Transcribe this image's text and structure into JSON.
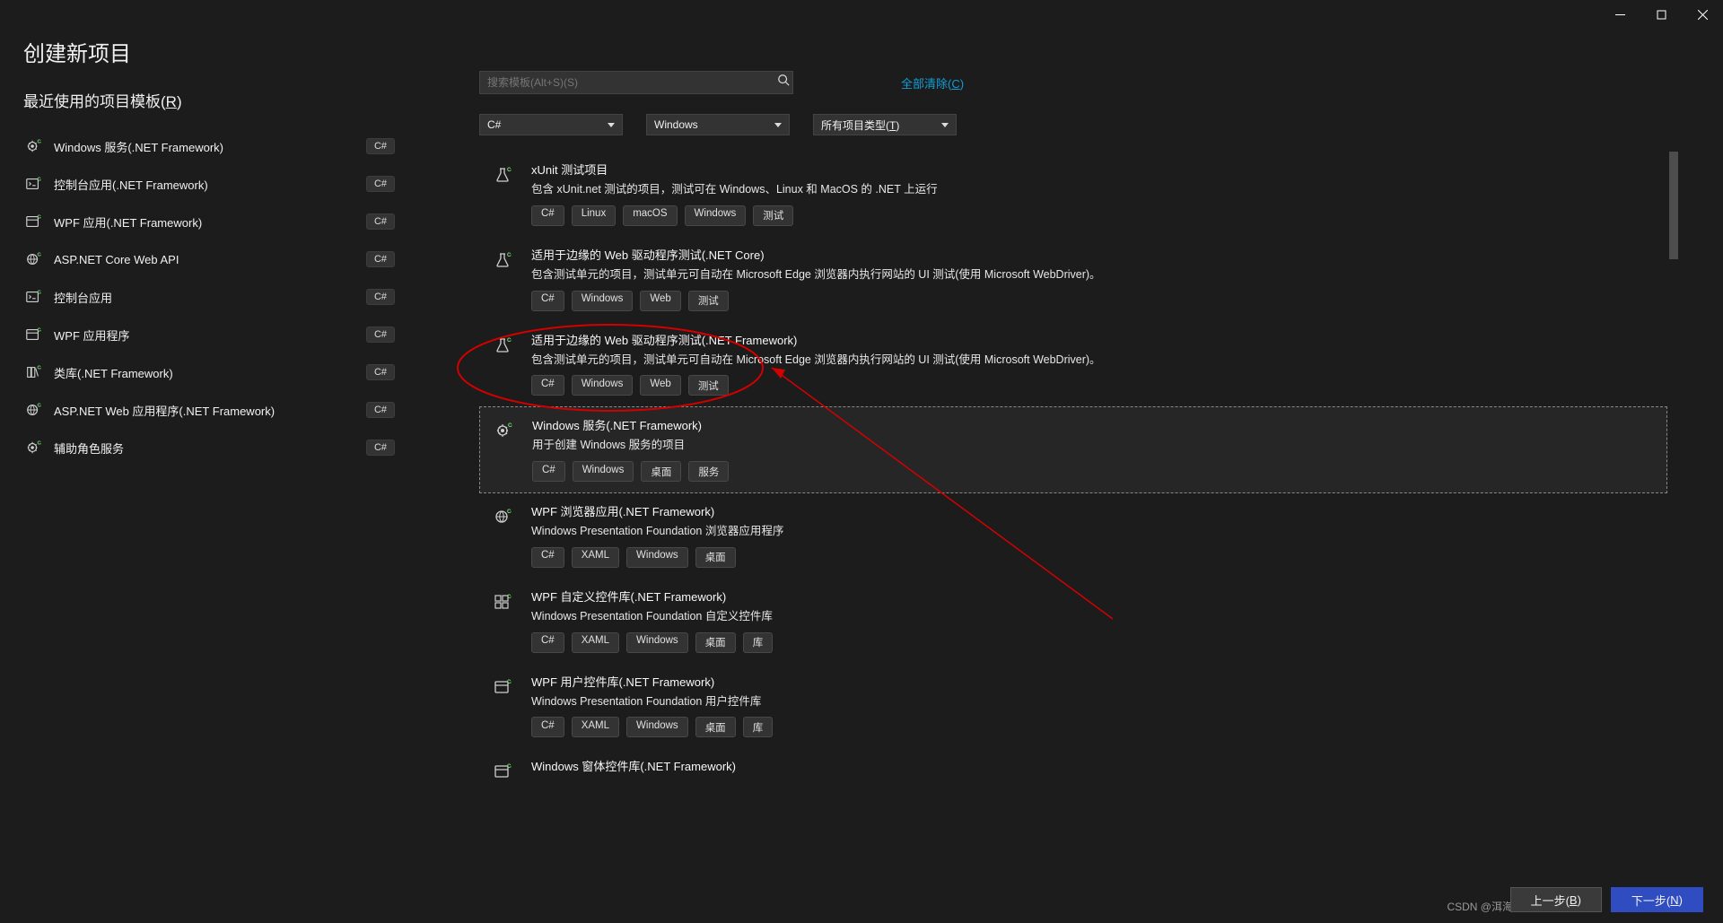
{
  "window": {
    "title": "创建新项目"
  },
  "recent": {
    "heading_prefix": "最近使用的项目模板(",
    "heading_u": "R",
    "heading_suffix": ")",
    "items": [
      {
        "name": "Windows 服务(.NET Framework)",
        "lang": "C#",
        "icon": "gear"
      },
      {
        "name": "控制台应用(.NET Framework)",
        "lang": "C#",
        "icon": "console"
      },
      {
        "name": "WPF 应用(.NET Framework)",
        "lang": "C#",
        "icon": "window"
      },
      {
        "name": "ASP.NET Core Web API",
        "lang": "C#",
        "icon": "globe"
      },
      {
        "name": "控制台应用",
        "lang": "C#",
        "icon": "console"
      },
      {
        "name": "WPF 应用程序",
        "lang": "C#",
        "icon": "window"
      },
      {
        "name": "类库(.NET Framework)",
        "lang": "C#",
        "icon": "lib"
      },
      {
        "name": "ASP.NET Web 应用程序(.NET Framework)",
        "lang": "C#",
        "icon": "globe"
      },
      {
        "name": "辅助角色服务",
        "lang": "C#",
        "icon": "gear"
      }
    ]
  },
  "search": {
    "placeholder": "搜索模板(Alt+S)(S)"
  },
  "clear_all_prefix": "全部清除(",
  "clear_all_u": "C",
  "clear_all_suffix": ")",
  "filters": {
    "items": [
      {
        "label": "C#"
      },
      {
        "label": "Windows"
      },
      {
        "label_prefix": "所有项目类型(",
        "label_u": "T",
        "label_suffix": ")"
      }
    ]
  },
  "templates": [
    {
      "title": "xUnit 测试项目",
      "desc": "包含 xUnit.net 测试的项目，测试可在 Windows、Linux 和 MacOS 的 .NET 上运行",
      "tags": [
        "C#",
        "Linux",
        "macOS",
        "Windows",
        "测试"
      ],
      "icon": "beaker"
    },
    {
      "title": "适用于边缘的 Web 驱动程序测试(.NET Core)",
      "desc": "包含测试单元的项目，测试单元可自动在 Microsoft Edge 浏览器内执行网站的 UI 测试(使用 Microsoft WebDriver)。",
      "tags": [
        "C#",
        "Windows",
        "Web",
        "测试"
      ],
      "icon": "beaker"
    },
    {
      "title": "适用于边缘的 Web 驱动程序测试(.NET Framework)",
      "desc": "包含测试单元的项目，测试单元可自动在 Microsoft Edge 浏览器内执行网站的 UI 测试(使用 Microsoft WebDriver)。",
      "tags": [
        "C#",
        "Windows",
        "Web",
        "测试"
      ],
      "icon": "beaker"
    },
    {
      "title": "Windows 服务(.NET Framework)",
      "desc": "用于创建 Windows 服务的项目",
      "tags": [
        "C#",
        "Windows",
        "桌面",
        "服务"
      ],
      "icon": "gear",
      "selected": true
    },
    {
      "title": "WPF 浏览器应用(.NET Framework)",
      "desc": "Windows Presentation Foundation 浏览器应用程序",
      "tags": [
        "C#",
        "XAML",
        "Windows",
        "桌面"
      ],
      "icon": "globe"
    },
    {
      "title": "WPF 自定义控件库(.NET Framework)",
      "desc": "Windows Presentation Foundation 自定义控件库",
      "tags": [
        "C#",
        "XAML",
        "Windows",
        "桌面",
        "库"
      ],
      "icon": "controls"
    },
    {
      "title": "WPF 用户控件库(.NET Framework)",
      "desc": "Windows Presentation Foundation 用户控件库",
      "tags": [
        "C#",
        "XAML",
        "Windows",
        "桌面",
        "库"
      ],
      "icon": "window"
    },
    {
      "title": "Windows 窗体控件库(.NET Framework)",
      "desc": "",
      "tags": [],
      "icon": "window",
      "partial": true
    }
  ],
  "footer": {
    "back_prefix": "上一步(",
    "back_u": "B",
    "back_suffix": ")",
    "next_prefix": "下一步(",
    "next_u": "N",
    "next_suffix": ")"
  },
  "watermark": "CSDN @洱海之月"
}
